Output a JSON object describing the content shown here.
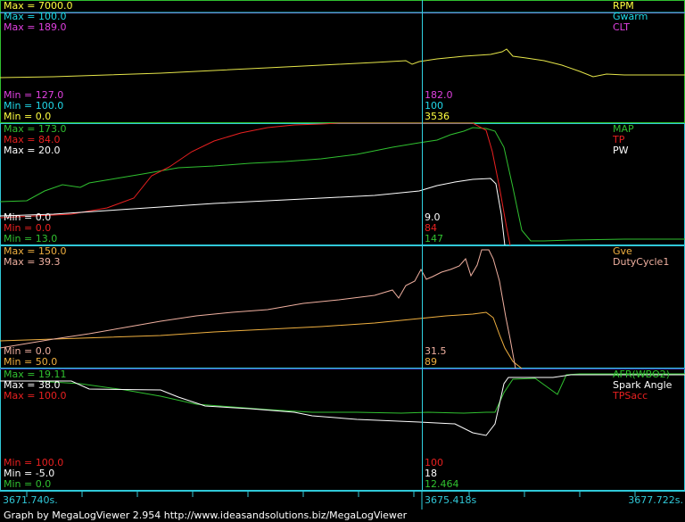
{
  "colors": {
    "rpm": "#e6e64a",
    "gwarm": "#20d8e8",
    "clt": "#e040e0",
    "map": "#30c030",
    "tp": "#e82020",
    "pw": "#ffffff",
    "gve": "#f0b040",
    "dutycycle": "#f0b0a0",
    "afr": "#30c030",
    "spark": "#ffffff",
    "tpsacc": "#e82020",
    "cursor": "#30d0e0",
    "border": "#30c8d8",
    "bg": "#000000"
  },
  "panels": [
    {
      "max_labels": [
        {
          "text": "Max = 7000.0",
          "color": "#ffff40"
        },
        {
          "text": "Max = 100.0",
          "color": "#20d8e8"
        },
        {
          "text": "Max = 189.0",
          "color": "#e040e0"
        }
      ],
      "min_labels": [
        {
          "text": "Min = 127.0",
          "color": "#e040e0"
        },
        {
          "text": "Min = 100.0",
          "color": "#20d8e8"
        },
        {
          "text": "Min = 0.0",
          "color": "#ffff40"
        }
      ],
      "names": [
        {
          "text": "RPM",
          "color": "#ffff40"
        },
        {
          "text": "Gwarm",
          "color": "#20d8e8"
        },
        {
          "text": "CLT",
          "color": "#e040e0"
        }
      ],
      "cursor_values": [
        {
          "text": "182.0",
          "color": "#e040e0"
        },
        {
          "text": "100",
          "color": "#20d8e8"
        },
        {
          "text": "3536",
          "color": "#ffff40"
        }
      ]
    },
    {
      "max_labels": [
        {
          "text": "Max = 173.0",
          "color": "#30c030"
        },
        {
          "text": "Max = 84.0",
          "color": "#e82020"
        },
        {
          "text": "Max = 20.0",
          "color": "#ffffff"
        }
      ],
      "min_labels": [
        {
          "text": "Min = 0.0",
          "color": "#ffffff"
        },
        {
          "text": "Min = 0.0",
          "color": "#e82020"
        },
        {
          "text": "Min = 13.0",
          "color": "#30c030"
        }
      ],
      "names": [
        {
          "text": "MAP",
          "color": "#30c030"
        },
        {
          "text": "TP",
          "color": "#e82020"
        },
        {
          "text": "PW",
          "color": "#ffffff"
        }
      ],
      "cursor_values": [
        {
          "text": "9.0",
          "color": "#ffffff"
        },
        {
          "text": "84",
          "color": "#e82020"
        },
        {
          "text": "147",
          "color": "#30c030"
        }
      ]
    },
    {
      "max_labels": [
        {
          "text": "Max = 150.0",
          "color": "#f0b040"
        },
        {
          "text": "Max = 39.3",
          "color": "#f0b0a0"
        }
      ],
      "min_labels": [
        {
          "text": "Min = 0.0",
          "color": "#f0b0a0"
        },
        {
          "text": "Min = 50.0",
          "color": "#f0b040"
        }
      ],
      "names": [
        {
          "text": "Gve",
          "color": "#f0b040"
        },
        {
          "text": "DutyCycle1",
          "color": "#f0b0a0"
        }
      ],
      "cursor_values": [
        {
          "text": "31.5",
          "color": "#f0b0a0"
        },
        {
          "text": "89",
          "color": "#f0b040"
        }
      ]
    },
    {
      "max_labels": [
        {
          "text": "Max = 19.11",
          "color": "#30c030"
        },
        {
          "text": "Max = 38.0",
          "color": "#ffffff"
        },
        {
          "text": "Max = 100.0",
          "color": "#e82020"
        }
      ],
      "min_labels": [
        {
          "text": "Min = 100.0",
          "color": "#e82020"
        },
        {
          "text": "Min = -5.0",
          "color": "#ffffff"
        },
        {
          "text": "Min = 0.0",
          "color": "#30c030"
        }
      ],
      "names": [
        {
          "text": "AFR(WBO2)",
          "color": "#30c030"
        },
        {
          "text": "Spark Angle",
          "color": "#ffffff"
        },
        {
          "text": "TPSacc",
          "color": "#e82020"
        }
      ],
      "cursor_values": [
        {
          "text": "100",
          "color": "#e82020"
        },
        {
          "text": "18",
          "color": "#ffffff"
        },
        {
          "text": "12.464",
          "color": "#30c030"
        }
      ]
    }
  ],
  "timebar": {
    "start": "3671.740s.",
    "cursor": "3675.418s",
    "end": "3677.722s."
  },
  "footer": "Graph by MegaLogViewer 2.954 http://www.ideasandsolutions.biz/MegaLogViewer"
}
